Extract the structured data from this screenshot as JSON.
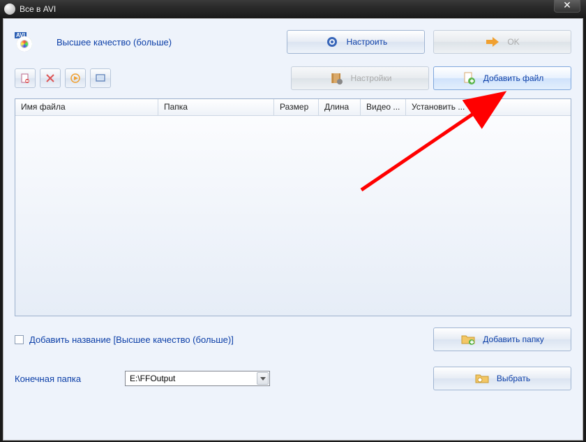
{
  "title": "Все в AVI",
  "quality_label": "Высшее качество (больше)",
  "buttons": {
    "configure": "Настроить",
    "ok": "OK",
    "settings": "Настройки",
    "add_file": "Добавить файл",
    "add_folder": "Добавить папку",
    "browse": "Выбрать"
  },
  "columns": {
    "name": "Имя файла",
    "folder": "Папка",
    "size": "Размер",
    "length": "Длина",
    "video": "Видео ...",
    "set": "Установить ..."
  },
  "checkbox_label": "Добавить название [Высшее качество (больше)]",
  "output_label": "Конечная папка",
  "output_path": "E:\\FFOutput",
  "avi_badge": "AVI"
}
